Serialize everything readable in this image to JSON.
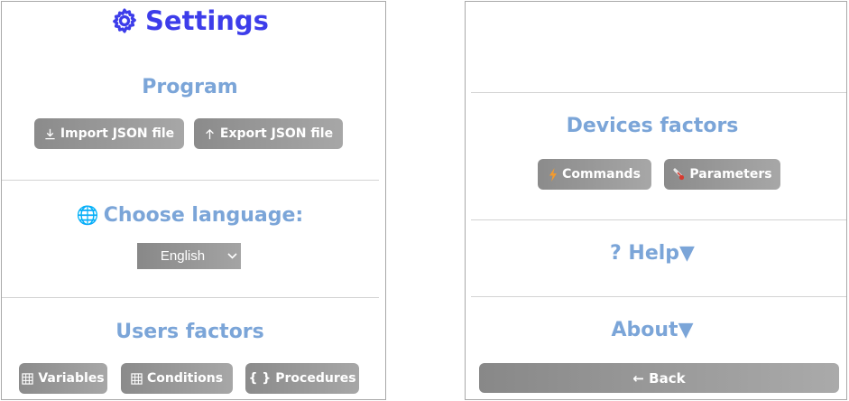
{
  "settings": {
    "title": "Settings",
    "title_icon": "gear-icon",
    "accent_color": "#3d3dea",
    "heading_color": "#7ba5d8"
  },
  "program": {
    "heading": "Program",
    "import_label": "Import JSON file",
    "export_label": "Export JSON file"
  },
  "language": {
    "globe": "🌐",
    "heading": "Choose language:",
    "selected": "English"
  },
  "users_factors": {
    "heading": "Users factors",
    "variables_label": "Variables",
    "conditions_label": "Conditions",
    "procedures_icon": "{ }",
    "procedures_label": "Procedures"
  },
  "devices_factors": {
    "heading": "Devices factors",
    "commands_label": "Commands",
    "parameters_label": "Parameters"
  },
  "help": {
    "label": "? Help▼"
  },
  "about": {
    "label": "About▼"
  },
  "back": {
    "label": "← Back"
  }
}
